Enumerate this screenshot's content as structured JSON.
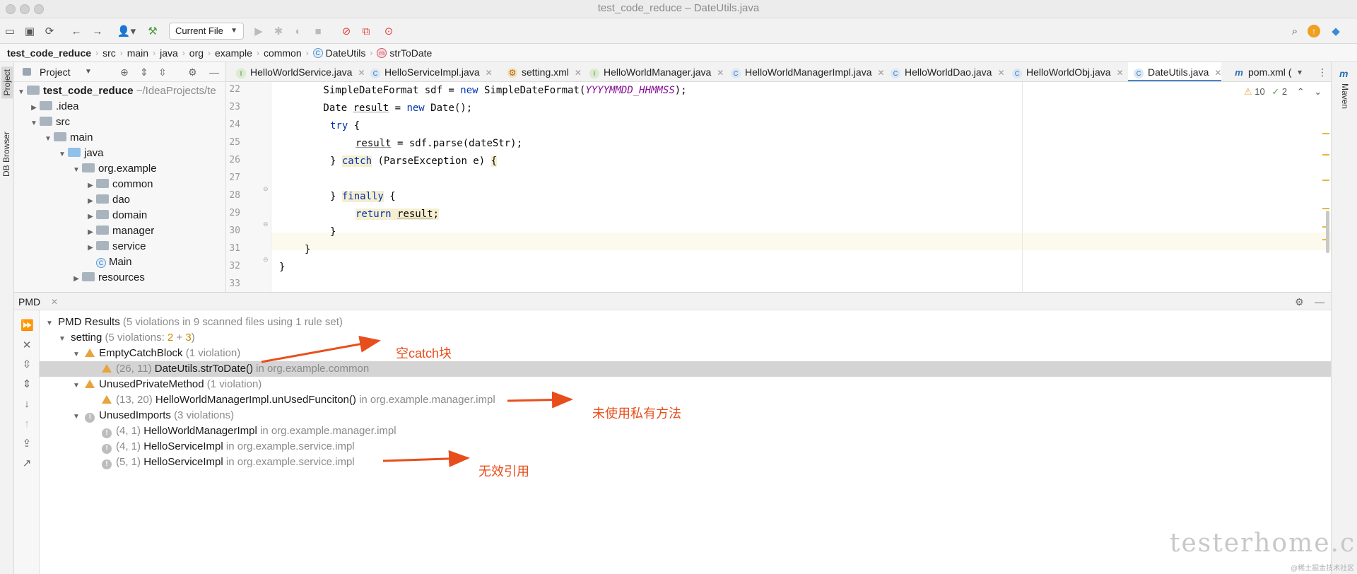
{
  "window": {
    "title": "test_code_reduce – DateUtils.java"
  },
  "toolbar": {
    "run_config": "Current File"
  },
  "breadcrumbs": [
    "test_code_reduce",
    "src",
    "main",
    "java",
    "org",
    "example",
    "common",
    "DateUtils",
    "strToDate"
  ],
  "left_strip": {
    "project_label": "Project",
    "db_label": "DB Browser"
  },
  "right_strip": {
    "maven_label": "Maven"
  },
  "project": {
    "header": "Project",
    "root_name": "test_code_reduce",
    "root_path": "~/IdeaProjects/te",
    "items": [
      ".idea",
      "src",
      "main",
      "java",
      "org.example",
      "common",
      "dao",
      "domain",
      "manager",
      "service",
      "Main",
      "resources"
    ]
  },
  "tabs": [
    {
      "label": "HelloWorldService.java",
      "icon": "interface-icon"
    },
    {
      "label": "HelloServiceImpl.java",
      "icon": "class-icon"
    },
    {
      "label": "setting.xml",
      "icon": "xml-icon"
    },
    {
      "label": "HelloWorldManager.java",
      "icon": "interface-icon"
    },
    {
      "label": "HelloWorldManagerImpl.java",
      "icon": "class-icon"
    },
    {
      "label": "HelloWorldDao.java",
      "icon": "class-icon"
    },
    {
      "label": "HelloWorldObj.java",
      "icon": "class-icon"
    },
    {
      "label": "DateUtils.java",
      "icon": "class-icon",
      "active": true
    },
    {
      "label": "pom.xml (",
      "icon": "maven-icon"
    }
  ],
  "editor": {
    "line_numbers": [
      "22",
      "23",
      "24",
      "25",
      "26",
      "27",
      "28",
      "29",
      "30",
      "31",
      "32",
      "33"
    ],
    "lines": {
      "l22_a": "        SimpleDateFormat sdf = ",
      "l22_new": "new",
      "l22_b": " SimpleDateFormat(",
      "l22_const": "YYYYMMDD_HHMMSS",
      "l22_c": ");",
      "l23_a": "        Date ",
      "l23_var": "result",
      "l23_b": " = ",
      "l23_new": "new",
      "l23_c": " Date();",
      "l24_try": "try",
      "l24_b": " {",
      "l25_var": "result",
      "l25_b": " = sdf.parse(dateStr);",
      "l26_a": "} ",
      "l26_catch": "catch",
      "l26_b": " (ParseException e) ",
      "l26_brace": "{",
      "l28_a": "} ",
      "l28_finally": "finally",
      "l28_b": " {",
      "l29_return": "return",
      "l29_sp": " ",
      "l29_var": "result",
      "l29_semi": ";",
      "l30": "}",
      "l31": "}",
      "l32": "}"
    },
    "warnings_count": "10",
    "weak_warnings_count": "2"
  },
  "pmd": {
    "panel_title": "PMD",
    "root_label": "PMD Results",
    "root_detail": "(5 violations in 9 scanned files using 1 rule set)",
    "ruleset": {
      "label": "setting",
      "detail_prefix": "(5 violations: ",
      "detail_warn": "2",
      "detail_plus": " + ",
      "detail_info": "3",
      "detail_suffix": ")"
    },
    "rules": [
      {
        "name": "EmptyCatchBlock",
        "count": "(1 violation)",
        "violations": [
          {
            "pos": "(26, 11)",
            "target": "DateUtils.strToDate()",
            "pkg": "in org.example.common"
          }
        ]
      },
      {
        "name": "UnusedPrivateMethod",
        "count": "(1 violation)",
        "violations": [
          {
            "pos": "(13, 20)",
            "target": "HelloWorldManagerImpl.unUsedFunciton()",
            "pkg": "in org.example.manager.impl"
          }
        ]
      },
      {
        "name": "UnusedImports",
        "count": "(3 violations)",
        "violations": [
          {
            "pos": "(4, 1)",
            "target": "HelloWorldManagerImpl",
            "pkg": "in org.example.manager.impl"
          },
          {
            "pos": "(4, 1)",
            "target": "HelloServiceImpl",
            "pkg": "in org.example.service.impl"
          },
          {
            "pos": "(5, 1)",
            "target": "HelloServiceImpl",
            "pkg": "in org.example.service.impl"
          }
        ]
      }
    ]
  },
  "annotations": [
    "空catch块",
    "未使用私有方法",
    "无效引用"
  ],
  "watermark": {
    "main": "testerhome.com",
    "small": "@稀土掘金技术社区"
  },
  "colors": {
    "accent": "#4a86c7",
    "annotation": "#e84e1b",
    "keyword": "#0033b3",
    "constant": "#871094",
    "warning": "#e8a33d"
  }
}
